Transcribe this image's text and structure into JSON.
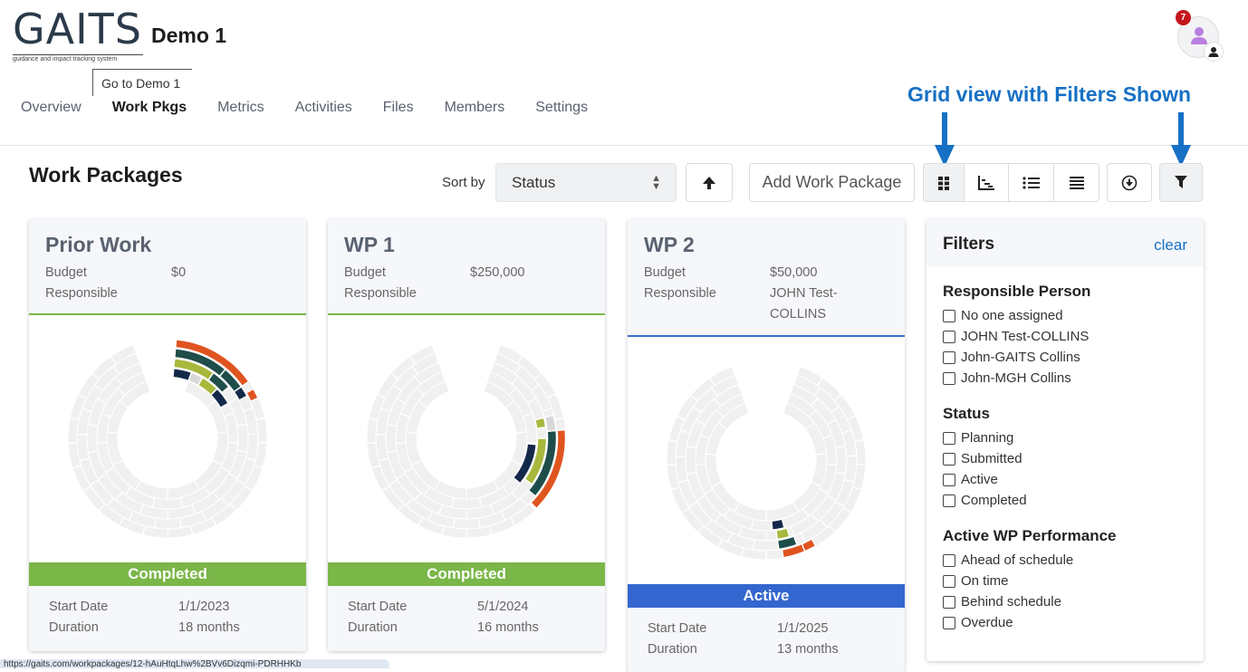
{
  "app": {
    "logo_text": "GAITS",
    "logo_tagline": "guidance and impact tracking system",
    "project_title": "Demo 1",
    "tooltip": "Go to Demo 1",
    "notification_count": "7"
  },
  "nav": {
    "items": [
      {
        "label": "Overview",
        "active": false
      },
      {
        "label": "Work Pkgs",
        "active": true
      },
      {
        "label": "Metrics",
        "active": false
      },
      {
        "label": "Activities",
        "active": false
      },
      {
        "label": "Files",
        "active": false
      },
      {
        "label": "Members",
        "active": false
      },
      {
        "label": "Settings",
        "active": false
      }
    ]
  },
  "annotation": {
    "text": "Grid view with Filters Shown",
    "color": "#1670c4"
  },
  "toolbar": {
    "heading": "Work Packages",
    "sort_label": "Sort by",
    "sort_value": "Status",
    "add_label": "Add Work Package",
    "view_icons": [
      "grid-view-icon",
      "timeline-view-icon",
      "list-view-icon",
      "table-view-icon"
    ],
    "active_view": "grid-view-icon"
  },
  "cards": [
    {
      "title": "Prior Work",
      "budget_label": "Budget",
      "budget": "$0",
      "responsible_label": "Responsible",
      "responsible": "",
      "status": "Completed",
      "status_color": "#7ab648",
      "head_border": "#7ab648",
      "start_label": "Start Date",
      "start": "1/1/2023",
      "duration_label": "Duration",
      "duration": "18 months"
    },
    {
      "title": "WP 1",
      "budget_label": "Budget",
      "budget": "$250,000",
      "responsible_label": "Responsible",
      "responsible": "",
      "status": "Completed",
      "status_color": "#7ab648",
      "head_border": "#7ab648",
      "start_label": "Start Date",
      "start": "5/1/2024",
      "duration_label": "Duration",
      "duration": "16 months"
    },
    {
      "title": "WP 2",
      "budget_label": "Budget",
      "budget": "$50,000",
      "responsible_label": "Responsible",
      "responsible": "JOHN Test-COLLINS",
      "status": "Active",
      "status_color": "#3466cf",
      "head_border": "#3a6fd0",
      "start_label": "Start Date",
      "start": "1/1/2025",
      "duration_label": "Duration",
      "duration": "13 months"
    }
  ],
  "ring_colors": {
    "navy": "#14294a",
    "olive": "#a8b83c",
    "teal": "#1e4d4a",
    "orange": "#e0541f",
    "grey": "#d8d8d8",
    "bg": "#f0f0f0"
  },
  "filters": {
    "title": "Filters",
    "clear": "clear",
    "groups": [
      {
        "title": "Responsible Person",
        "options": [
          "No one assigned",
          "JOHN Test-COLLINS",
          "John-GAITS Collins",
          "John-MGH Collins"
        ]
      },
      {
        "title": "Status",
        "options": [
          "Planning",
          "Submitted",
          "Active",
          "Completed"
        ]
      },
      {
        "title": "Active WP Performance",
        "options": [
          "Ahead of schedule",
          "On time",
          "Behind schedule",
          "Overdue"
        ]
      }
    ]
  },
  "status_url": "https://gaits.com/workpackages/12-hAuHtqLhw%2BVv6Dizqmi-PDRHHKb"
}
